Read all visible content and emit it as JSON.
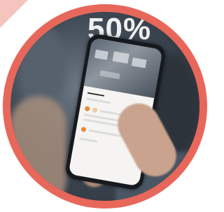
{
  "image": {
    "description_color": {
      "ring": "#e8675b",
      "corner": "#f6c4bf"
    },
    "sign_text": "50%"
  }
}
